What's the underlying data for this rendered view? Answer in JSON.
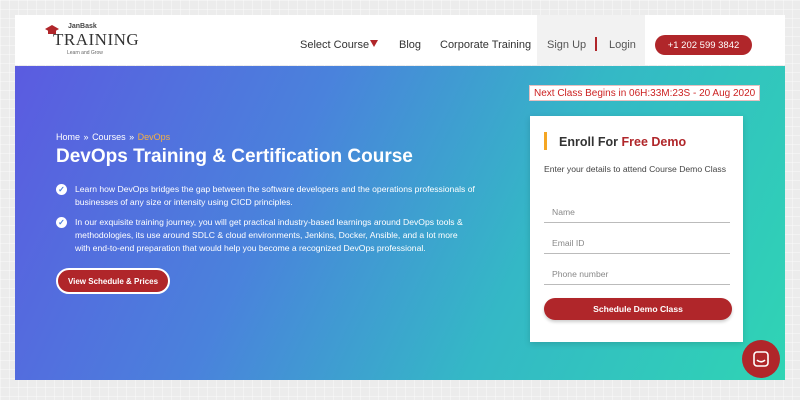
{
  "logo": {
    "brand_small": "JanBask",
    "brand_main": "TRAINING",
    "tagline": "Learn and Grow"
  },
  "nav": {
    "select_course": "Select Course",
    "blog": "Blog",
    "corporate_training": "Corporate Training",
    "sign_up": "Sign Up",
    "login": "Login",
    "phone": "+1 202 599 3842"
  },
  "hero": {
    "next_class": "Next Class Begins in 06H:33M:23S - 20 Aug 2020",
    "breadcrumb": [
      "Home",
      "Courses",
      "DevOps"
    ],
    "breadcrumb_sep": "»",
    "title": "DevOps Training & Certification Course",
    "bullets": [
      "Learn how DevOps bridges the gap between the software developers and the operations professionals of businesses of any size or intensity using CICD principles.",
      "In our exquisite training journey, you will get practical industry-based learnings around DevOps tools & methodologies, its use around SDLC & cloud environments, Jenkins, Docker, Ansible, and a lot more with end-to-end preparation that would help you become a recognized DevOps professional."
    ],
    "cta": "View Schedule & Prices"
  },
  "form": {
    "title_prefix": "Enroll For",
    "title_accent": "Free Demo",
    "description": "Enter your details to attend Course Demo Class",
    "name_placeholder": "Name",
    "email_placeholder": "Email ID",
    "phone_placeholder": "Phone number",
    "submit": "Schedule Demo Class"
  },
  "colors": {
    "brand_red": "#b0262a",
    "accent_orange": "#f5a623",
    "gradient_start": "#5b5be0",
    "gradient_end": "#2fd4b4"
  },
  "icons": [
    "graduation-cap-icon",
    "caret-down-icon",
    "check-icon",
    "chat-icon"
  ]
}
